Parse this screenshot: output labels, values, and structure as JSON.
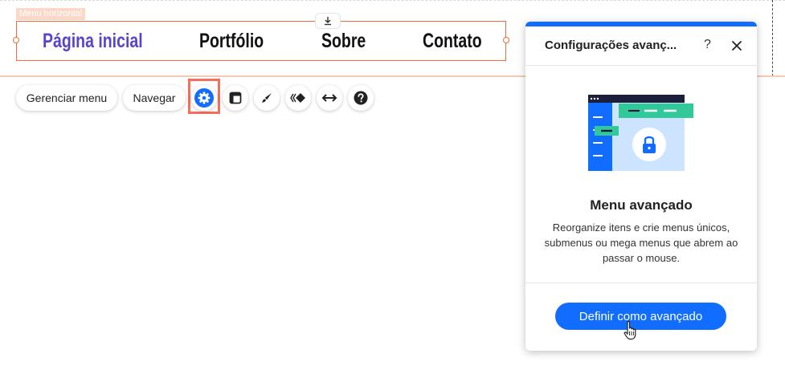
{
  "canvas": {
    "menu_label": "Menu horizontal",
    "menu_items": [
      {
        "label": "Página inicial",
        "active": true
      },
      {
        "label": "Portfólio",
        "active": false
      },
      {
        "label": "Sobre",
        "active": false
      },
      {
        "label": "Contato",
        "active": false
      }
    ],
    "download_icon": "download-icon"
  },
  "toolbar": {
    "manage_menu_label": "Gerenciar menu",
    "navigate_label": "Navegar",
    "icons": [
      "settings-icon",
      "layout-icon",
      "design-brush-icon",
      "animation-icon",
      "stretch-icon",
      "help-icon"
    ]
  },
  "panel": {
    "title": "Configurações avanç...",
    "help_label": "?",
    "heading": "Menu avançado",
    "description": "Reorganize itens e crie menus únicos, submenus ou mega menus que abrem ao passar o mouse.",
    "cta_label": "Definir como avançado"
  },
  "colors": {
    "accent": "#116dff",
    "active_menu": "#5b43c9",
    "selection": "#f26b3a",
    "highlight": "#f36f5c"
  }
}
